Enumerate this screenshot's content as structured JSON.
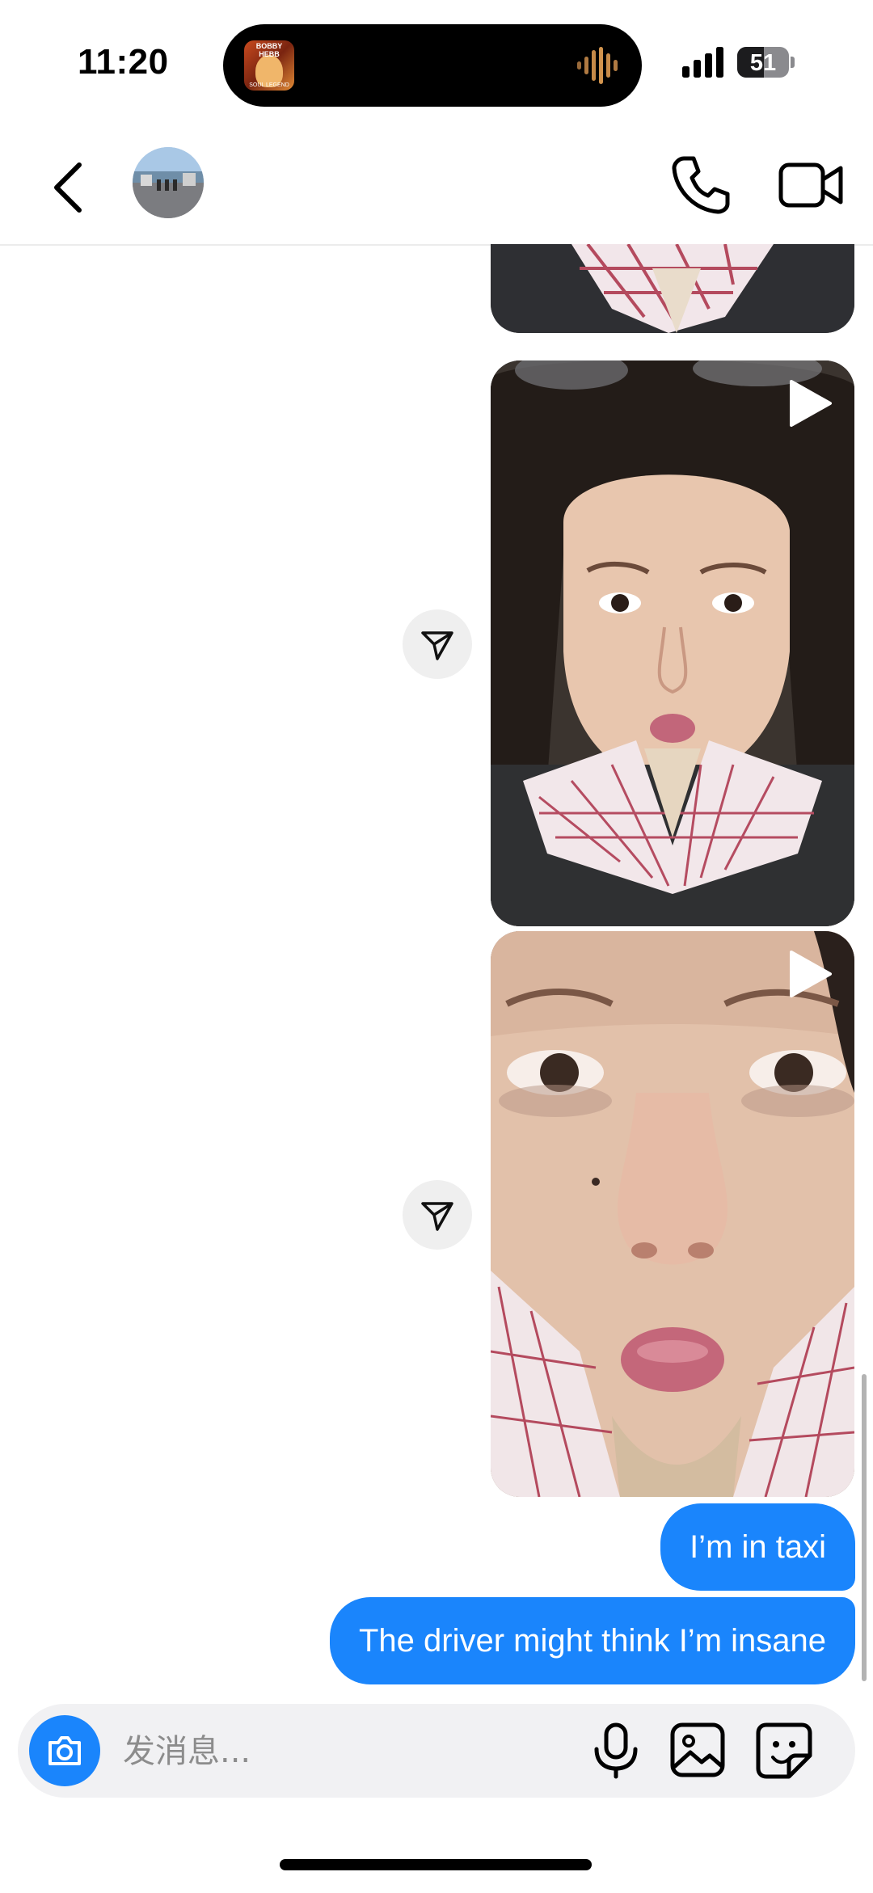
{
  "status_bar": {
    "time": "11:20",
    "battery": "51",
    "battery_level_percent": 51,
    "now_playing_art_title": "BOBBY HEBB",
    "now_playing_art_subtitle": "SOUL LEGEND"
  },
  "header": {
    "back_icon": "chevron-left-icon",
    "call_icon": "phone-icon",
    "video_icon": "video-camera-icon"
  },
  "messages": [
    {
      "type": "media",
      "sender": "other",
      "content": "video",
      "partial": true
    },
    {
      "type": "media",
      "sender": "other",
      "content": "video",
      "icon": "play-icon",
      "share_icon": "send-icon"
    },
    {
      "type": "media",
      "sender": "other",
      "content": "video",
      "icon": "play-icon",
      "share_icon": "send-icon"
    },
    {
      "type": "text",
      "sender": "me",
      "text": "I’m in taxi"
    },
    {
      "type": "text",
      "sender": "me",
      "text": "The driver might think I’m insane"
    }
  ],
  "composer": {
    "placeholder": "发消息...",
    "camera_icon": "camera-icon",
    "mic_icon": "microphone-icon",
    "gallery_icon": "image-icon",
    "sticker_icon": "sticker-icon"
  },
  "colors": {
    "accent": "#1a85fc",
    "bubble_text": "#ffffff",
    "background": "#ffffff"
  }
}
